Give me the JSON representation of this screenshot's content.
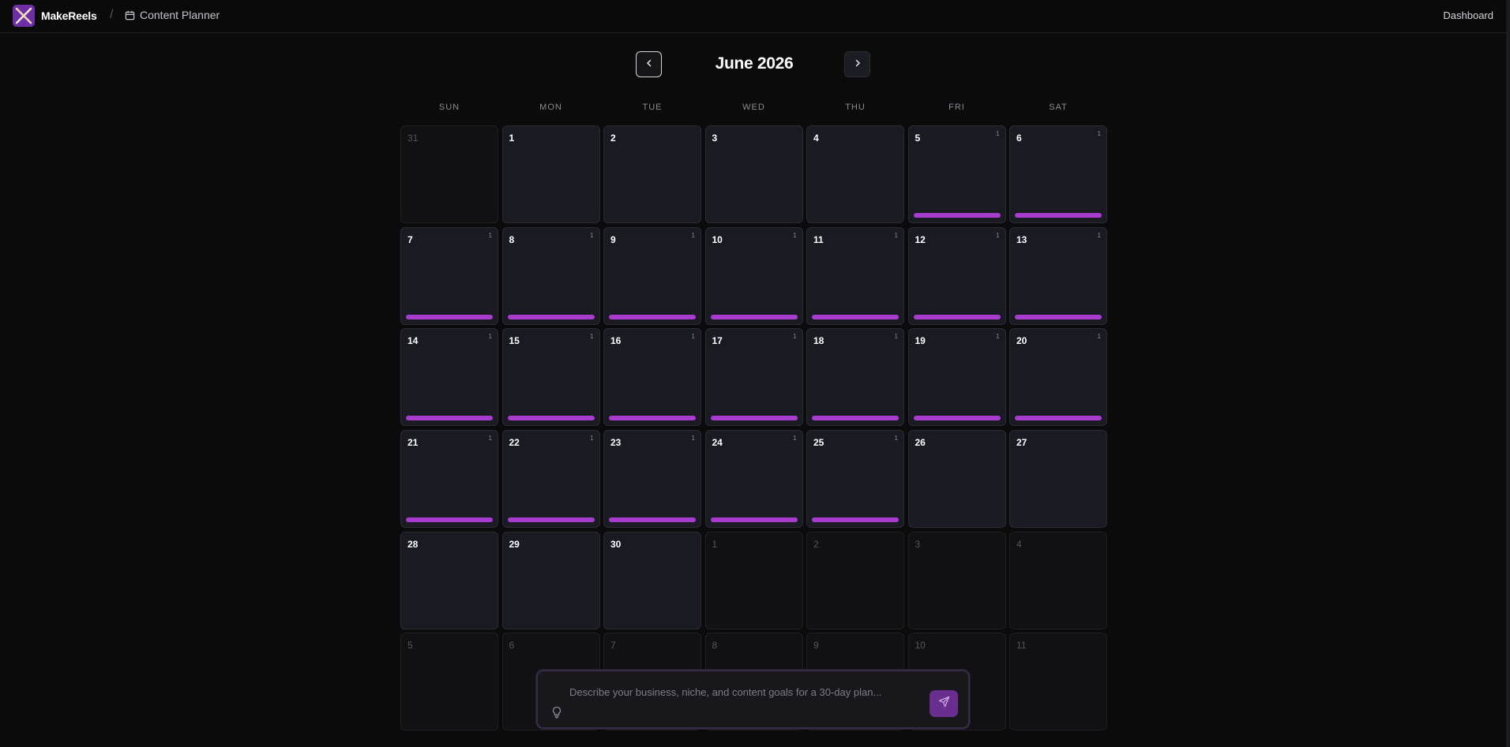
{
  "app": {
    "brand": "MakeReels",
    "breadcrumb_sep": "/",
    "breadcrumb": "Content Planner",
    "dashboard_link": "Dashboard"
  },
  "calendar": {
    "month_title": "June 2026",
    "weekdays": [
      "SUN",
      "MON",
      "TUE",
      "WED",
      "THU",
      "FRI",
      "SAT"
    ],
    "days": [
      {
        "num": "31",
        "outside": true,
        "count": "",
        "bar": false
      },
      {
        "num": "1",
        "outside": false,
        "count": "",
        "bar": false
      },
      {
        "num": "2",
        "outside": false,
        "count": "",
        "bar": false
      },
      {
        "num": "3",
        "outside": false,
        "count": "",
        "bar": false
      },
      {
        "num": "4",
        "outside": false,
        "count": "",
        "bar": false
      },
      {
        "num": "5",
        "outside": false,
        "count": "1",
        "bar": true
      },
      {
        "num": "6",
        "outside": false,
        "count": "1",
        "bar": true
      },
      {
        "num": "7",
        "outside": false,
        "count": "1",
        "bar": true
      },
      {
        "num": "8",
        "outside": false,
        "count": "1",
        "bar": true
      },
      {
        "num": "9",
        "outside": false,
        "count": "1",
        "bar": true
      },
      {
        "num": "10",
        "outside": false,
        "count": "1",
        "bar": true
      },
      {
        "num": "11",
        "outside": false,
        "count": "1",
        "bar": true
      },
      {
        "num": "12",
        "outside": false,
        "count": "1",
        "bar": true
      },
      {
        "num": "13",
        "outside": false,
        "count": "1",
        "bar": true
      },
      {
        "num": "14",
        "outside": false,
        "count": "1",
        "bar": true
      },
      {
        "num": "15",
        "outside": false,
        "count": "1",
        "bar": true
      },
      {
        "num": "16",
        "outside": false,
        "count": "1",
        "bar": true
      },
      {
        "num": "17",
        "outside": false,
        "count": "1",
        "bar": true
      },
      {
        "num": "18",
        "outside": false,
        "count": "1",
        "bar": true
      },
      {
        "num": "19",
        "outside": false,
        "count": "1",
        "bar": true
      },
      {
        "num": "20",
        "outside": false,
        "count": "1",
        "bar": true
      },
      {
        "num": "21",
        "outside": false,
        "count": "1",
        "bar": true
      },
      {
        "num": "22",
        "outside": false,
        "count": "1",
        "bar": true
      },
      {
        "num": "23",
        "outside": false,
        "count": "1",
        "bar": true
      },
      {
        "num": "24",
        "outside": false,
        "count": "1",
        "bar": true
      },
      {
        "num": "25",
        "outside": false,
        "count": "1",
        "bar": true
      },
      {
        "num": "26",
        "outside": false,
        "count": "",
        "bar": false
      },
      {
        "num": "27",
        "outside": false,
        "count": "",
        "bar": false
      },
      {
        "num": "28",
        "outside": false,
        "count": "",
        "bar": false
      },
      {
        "num": "29",
        "outside": false,
        "count": "",
        "bar": false
      },
      {
        "num": "30",
        "outside": false,
        "count": "",
        "bar": false
      },
      {
        "num": "1",
        "outside": true,
        "count": "",
        "bar": false
      },
      {
        "num": "2",
        "outside": true,
        "count": "",
        "bar": false
      },
      {
        "num": "3",
        "outside": true,
        "count": "",
        "bar": false
      },
      {
        "num": "4",
        "outside": true,
        "count": "",
        "bar": false
      },
      {
        "num": "5",
        "outside": true,
        "count": "",
        "bar": false
      },
      {
        "num": "6",
        "outside": true,
        "count": "",
        "bar": false
      },
      {
        "num": "7",
        "outside": true,
        "count": "",
        "bar": false
      },
      {
        "num": "8",
        "outside": true,
        "count": "",
        "bar": false
      },
      {
        "num": "9",
        "outside": true,
        "count": "",
        "bar": false
      },
      {
        "num": "10",
        "outside": true,
        "count": "",
        "bar": false
      },
      {
        "num": "11",
        "outside": true,
        "count": "",
        "bar": false
      }
    ]
  },
  "prompt": {
    "placeholder": "Describe your business, niche, and content goals for a 30-day plan...",
    "value": ""
  },
  "icons": {
    "logo": "makereels-logo-icon",
    "breadcrumb": "calendar-icon",
    "prev": "chevron-left-icon",
    "next": "chevron-right-icon",
    "hint": "lightbulb-icon",
    "send": "send-icon"
  },
  "colors": {
    "accent": "#a73ccf",
    "brand": "#7b35b0",
    "background": "#0b0b0c",
    "cell": "#1a1b22"
  }
}
